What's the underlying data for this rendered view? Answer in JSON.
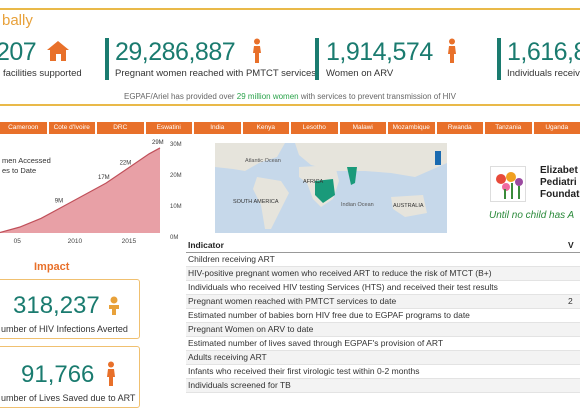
{
  "header": {
    "title": "bally",
    "kpis": [
      {
        "value": "207",
        "label": "facilities supported",
        "icon": "hospital-icon"
      },
      {
        "value": "29,286,887",
        "label": "Pregnant women reached with PMTCT services",
        "icon": "pregnant-woman-icon"
      },
      {
        "value": "1,914,574",
        "label": "Women on ARV",
        "icon": "woman-icon"
      },
      {
        "value": "1,616,8",
        "label": "Individuals receivin",
        "icon": "person-icon"
      }
    ],
    "banner_prefix": "EGPAF/Ariel has provided over",
    "banner_highlight": "29 million women",
    "banner_suffix": "with services to prevent transmission of HIV"
  },
  "country_tabs": [
    "Cameroon",
    "Cote d'Ivoire",
    "DRC",
    "Eswatini",
    "India",
    "Kenya",
    "Lesotho",
    "Malawi",
    "Mozambique",
    "Rwanda",
    "Tanzania",
    "Uganda"
  ],
  "trend_chart": {
    "title_line1": "men Accessed",
    "title_line2": "es to Date",
    "x_ticks": [
      "05",
      "2010",
      "2015"
    ],
    "point_labels": [
      "9M",
      "17M",
      "22M",
      "29M"
    ],
    "colors": {
      "fill": "#e8a0a6",
      "line": "#c0505a"
    }
  },
  "chart_data": {
    "type": "area",
    "x": [
      2003,
      2005,
      2007,
      2009,
      2011,
      2013,
      2015,
      2017,
      2018
    ],
    "values": [
      0,
      2,
      5,
      9,
      13,
      17,
      22,
      27,
      29
    ],
    "labeled_points": [
      {
        "x": 2009,
        "label": "9M"
      },
      {
        "x": 2013,
        "label": "17M"
      },
      {
        "x": 2015,
        "label": "22M"
      },
      {
        "x": 2018,
        "label": "29M"
      }
    ],
    "ylim": [
      0,
      30
    ],
    "xlabel": "",
    "ylabel": ""
  },
  "map": {
    "y_ticks": [
      "30M",
      "20M",
      "10M",
      "0M"
    ],
    "labels": {
      "north_america": "",
      "atlantic": "Atlantic Ocean",
      "africa": "AFRICA",
      "south_america": "SOUTH AMERICA",
      "indian": "Indian Ocean",
      "australia": "AUSTRALIA"
    },
    "colors": {
      "ocean": "#c6d8ea",
      "land": "#e6e4dc",
      "highlight": "#1a9a7a"
    }
  },
  "foundation": {
    "name_line1": "Elizabet",
    "name_line2": "Pediatri",
    "name_line3": "Foundat",
    "tagline": "Until no child has A"
  },
  "impact": {
    "title": "Impact",
    "cards": [
      {
        "value": "318,237",
        "label": "umber of HIV Infections Averted",
        "icon": "child-icon"
      },
      {
        "value": "91,766",
        "label": "umber of Lives Saved due to ART",
        "icon": "person-icon"
      }
    ]
  },
  "indicator_table": {
    "header": "Indicator",
    "value_header": "V",
    "rows": [
      {
        "indicator": "Children receiving ART",
        "value": ""
      },
      {
        "indicator": "HIV-positive pregnant women who received ART to reduce the risk of MTCT (B+)",
        "value": ""
      },
      {
        "indicator": "Individuals who received HIV testing Services (HTS) and received their test results",
        "value": ""
      },
      {
        "indicator": "Pregnant women reached with PMTCT services to date",
        "value": "2"
      },
      {
        "indicator": "Estimated number of babies born HIV free due to EGPAF programs to date",
        "value": ""
      },
      {
        "indicator": "Pregnant Women on ARV to date",
        "value": ""
      },
      {
        "indicator": "Estimated number of lives saved through EGPAF's provision of ART",
        "value": ""
      },
      {
        "indicator": "Adults receiving ART",
        "value": ""
      },
      {
        "indicator": "Infants who received their first virologic test within 0-2 months",
        "value": ""
      },
      {
        "indicator": "Individuals screened for TB",
        "value": ""
      }
    ]
  },
  "colors": {
    "teal": "#1a7b6f",
    "orange": "#e8702a",
    "gold": "#e9b949"
  }
}
